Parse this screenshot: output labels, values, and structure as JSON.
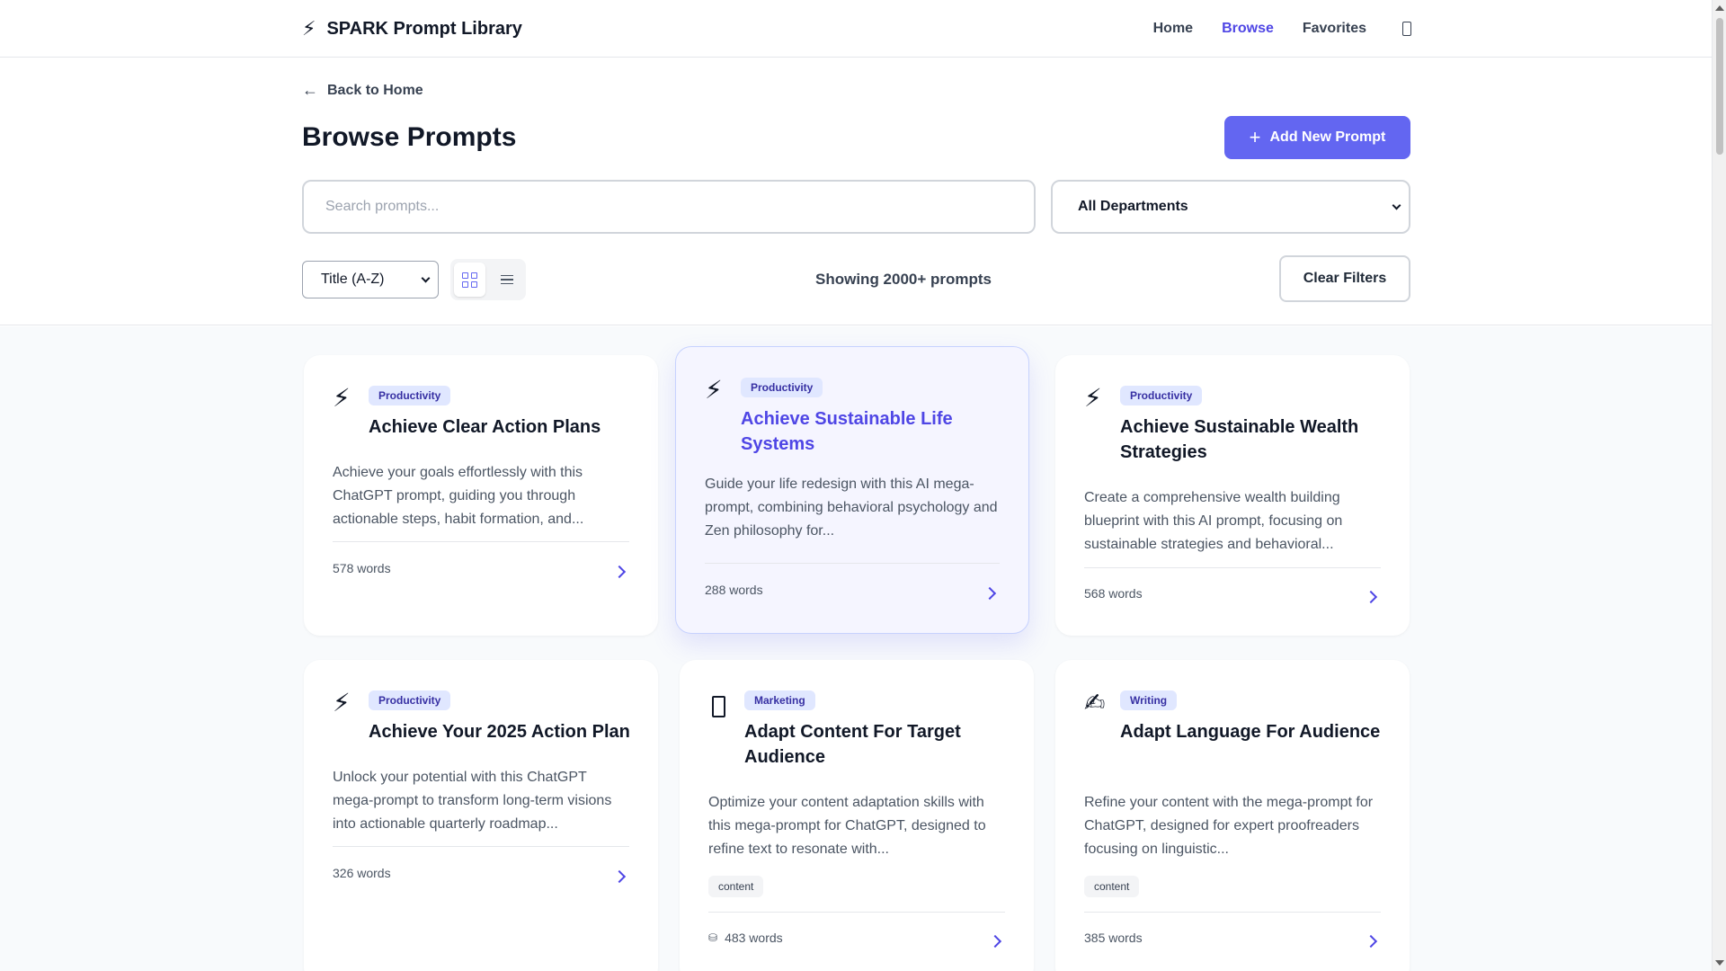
{
  "nav": {
    "brand_icon": "⚡",
    "brand": "SPARK Prompt Library",
    "links": [
      "Home",
      "Browse",
      "Favorites"
    ],
    "active": "Browse",
    "theme_icon": "moon-icon",
    "accent_color": "#4f46e5"
  },
  "header": {
    "back_label": "Back to Home",
    "title": "Browse Prompts",
    "add_button": "Add New Prompt",
    "search_placeholder": "Search prompts...",
    "department_select": "All Departments",
    "sort_select": "Title (A-Z)",
    "view_mode": "grid",
    "result_count": "Showing 2000+ prompts",
    "clear_button": "Clear Filters"
  },
  "cards": [
    {
      "icon": "⚡",
      "category": "Productivity",
      "title": "Achieve Clear Action Plans",
      "description": "Achieve your goals effortlessly with this ChatGPT prompt, guiding you through actionable steps, habit formation, and...",
      "words": "578 words"
    },
    {
      "icon": "⚡",
      "category": "Productivity",
      "title": "Achieve Sustainable Life Systems",
      "description": "Guide your life redesign with this AI mega-prompt, combining behavioral psychology and Zen philosophy for...",
      "words": "288 words"
    },
    {
      "icon": "⚡",
      "category": "Productivity",
      "title": "Achieve Sustainable Wealth Strategies",
      "description": "Create a comprehensive wealth building blueprint with this AI prompt, focusing on sustainable strategies and behavioral...",
      "words": "568 words"
    },
    {
      "icon": "⚡",
      "category": "Productivity",
      "title": "Achieve Your 2025 Action Plan",
      "description": "Unlock your potential with this ChatGPT mega-prompt to transform long-term visions into actionable quarterly roadmap...",
      "words": "326 words"
    },
    {
      "icon": "",
      "category": "Marketing",
      "title": "Adapt Content For Target Audience",
      "description": "Optimize your content adaptation skills with this mega-prompt for ChatGPT, designed to refine text to resonate with...",
      "tag": "content",
      "words_icon": "⛁",
      "words": "483 words"
    },
    {
      "icon": "✍",
      "category": "Writing",
      "title": "Adapt Language For Audience",
      "description": "Refine your content with the mega-prompt for ChatGPT, designed for expert proofreaders focusing on linguistic...",
      "tag": "content",
      "words": "385 words"
    }
  ]
}
